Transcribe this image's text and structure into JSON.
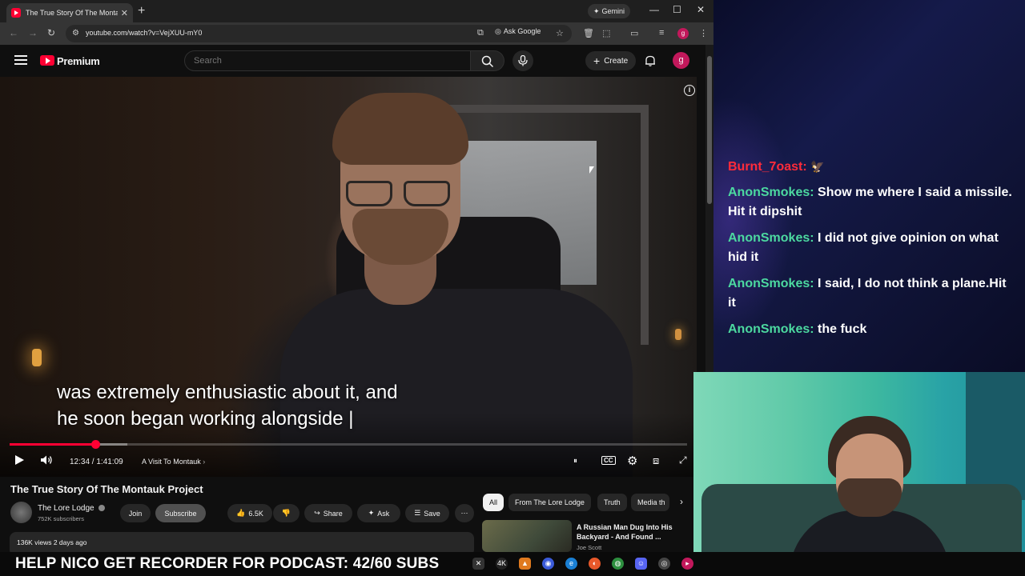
{
  "browser": {
    "tab_title": "The True Story Of The Montauk",
    "gemini_label": "Gemini",
    "url": "youtube.com/watch?v=VejXUU-mY0",
    "ask_google_label": "Ask Google",
    "profile_initial": "g"
  },
  "youtube": {
    "brand": "Premium",
    "search_placeholder": "Search",
    "create_label": "Create",
    "avatar_initial": "g"
  },
  "player": {
    "captions": [
      "was extremely enthusiastic about it, and",
      "he soon began working alongside |"
    ],
    "timecode": "12:34 / 1:41:09",
    "chapter": "A Visit To Montauk",
    "progress": {
      "played_fraction": 0.126,
      "buffered_fraction": 0.048
    },
    "captions_enabled": true,
    "accent_color": "#ff0033"
  },
  "video_info": {
    "title": "The True Story Of The Montauk Project",
    "channel_name": "The Lore Lodge",
    "subscribers": "752K subscribers",
    "join_label": "Join",
    "subscribe_label": "Subscribe",
    "like_count": "6.5K",
    "share_label": "Share",
    "ask_label": "Ask",
    "save_label": "Save",
    "views_date": "136K views  2 days ago"
  },
  "related": {
    "chips": [
      "All",
      "From The Lore Lodge",
      "Truth",
      "Media th"
    ],
    "active_chip": "All",
    "items": [
      {
        "title": "A Russian Man Dug Into His Backyard - And Found ...",
        "channel": "Joe Scott"
      }
    ]
  },
  "chat": {
    "messages": [
      {
        "author": "Burnt_7oast:",
        "text": "",
        "author_color": "#ff2b3a"
      },
      {
        "author": "AnonSmokes:",
        "text": "Show me where I said a missile. Hit it dipshit",
        "author_color": "#4cd9a0"
      },
      {
        "author": "AnonSmokes:",
        "text": "I did not give opinion on what hid it",
        "author_color": "#4cd9a0"
      },
      {
        "author": "AnonSmokes:",
        "text": "I said, I do not think a plane.Hit it",
        "author_color": "#4cd9a0"
      },
      {
        "author": "AnonSmokes:",
        "text": "the fuck",
        "author_color": "#4cd9a0"
      }
    ]
  },
  "banner": {
    "text": "HELP NICO GET RECORDER FOR PODCAST: 42/60 SUBS"
  }
}
